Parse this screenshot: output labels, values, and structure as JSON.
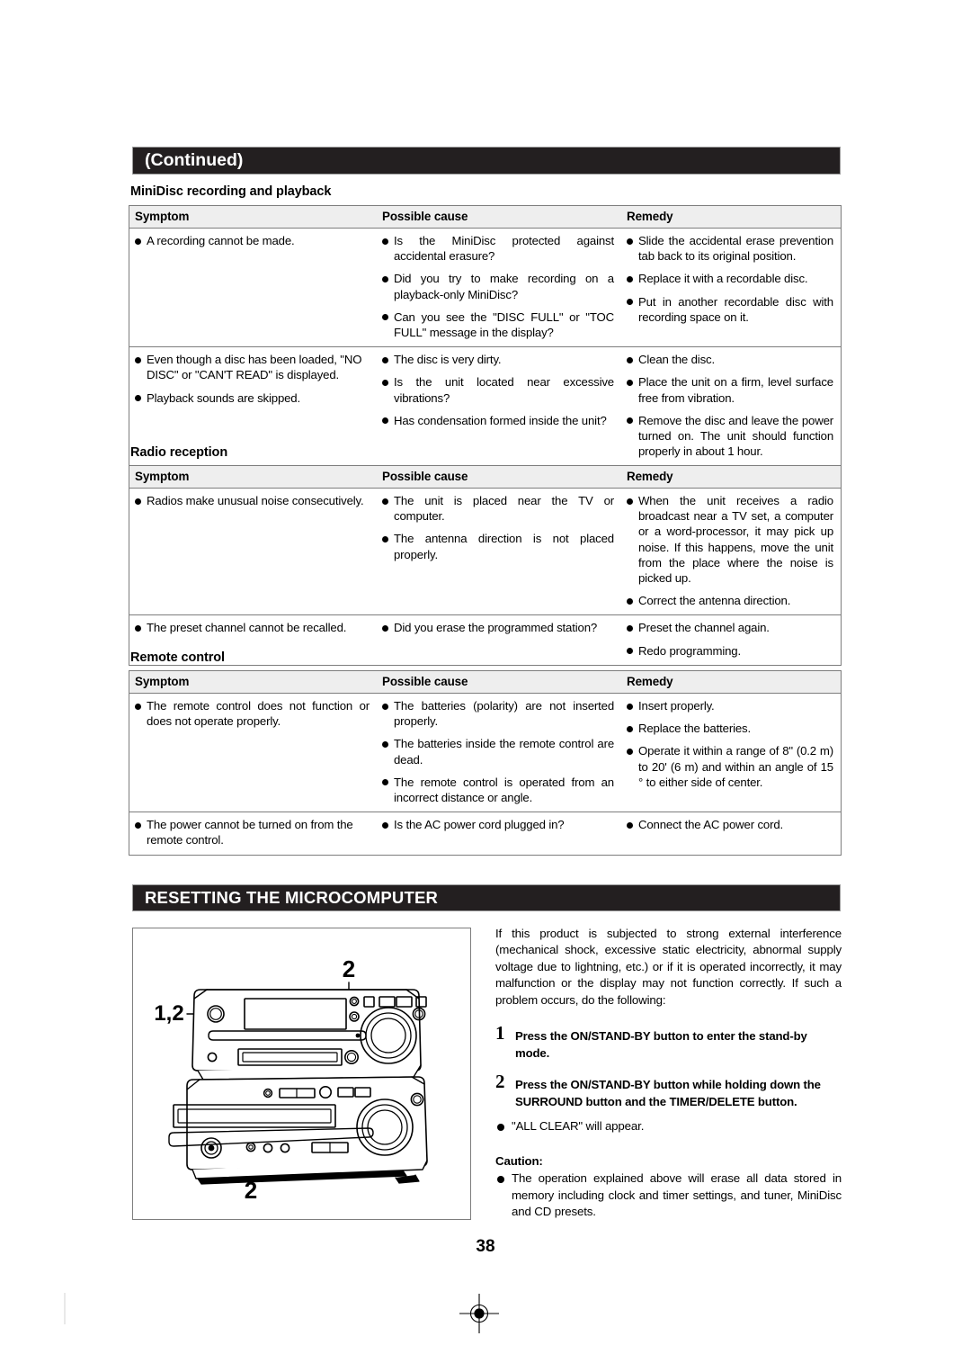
{
  "banners": {
    "continued": "(Continued)",
    "resetting": "RESETTING THE MICROCOMPUTER"
  },
  "columns": {
    "symptom": "Symptom",
    "cause": "Possible cause",
    "remedy": "Remedy"
  },
  "sections": [
    {
      "heading": "MiniDisc recording and playback",
      "rows": [
        {
          "symptom": [
            "A recording cannot be made."
          ],
          "cause": [
            "Is the MiniDisc protected against accidental erasure?",
            "Did you try to make recording on a playback-only MiniDisc?",
            "Can you see the \"DISC FULL\" or \"TOC FULL\" message in the display?"
          ],
          "remedy": [
            "Slide the accidental erase prevention tab back to its original position.",
            "Replace it with a recordable disc.",
            "Put in another recordable disc with recording space on it."
          ]
        },
        {
          "symptom": [
            "Even though a disc has been loaded, \"NO DISC\" or \"CAN'T READ\" is displayed.",
            "Playback sounds are skipped."
          ],
          "cause": [
            "The disc is very dirty.",
            "Is the unit located near excessive vibrations?",
            "Has condensation formed inside the unit?"
          ],
          "remedy": [
            "Clean the disc.",
            "Place the unit on a firm, level surface free from vibration.",
            "Remove the disc and leave the power turned on. The unit should function properly in about 1 hour."
          ]
        }
      ]
    },
    {
      "heading": "Radio reception",
      "rows": [
        {
          "symptom": [
            "Radios make unusual noise consecutively."
          ],
          "cause": [
            "The unit is placed near the TV or computer.",
            "The antenna direction is not placed properly."
          ],
          "remedy": [
            "When the unit receives a radio broadcast near a TV set, a computer or a word-processor, it may pick up noise. If this happens, move the unit from the place where the noise is picked up.",
            "Correct the antenna direction."
          ]
        },
        {
          "symptom": [
            "The preset channel cannot be recalled."
          ],
          "cause": [
            "Did you erase the programmed station?"
          ],
          "remedy": [
            "Preset the channel again.",
            "Redo programming."
          ]
        }
      ]
    },
    {
      "heading": "Remote control",
      "rows": [
        {
          "symptom": [
            "The remote control does not function or does not operate properly."
          ],
          "cause": [
            "The batteries (polarity) are not inserted properly.",
            "The batteries inside the remote control are dead.",
            "The remote control is operated from an incorrect distance or angle."
          ],
          "remedy": [
            "Insert properly.",
            "Replace the batteries.",
            "Operate it within a range of 8\" (0.2 m) to 20' (6 m) and within an angle of 15 ° to either side of center."
          ]
        },
        {
          "symptom": [
            "The power cannot be turned on from the remote control."
          ],
          "cause": [
            "Is the AC power cord plugged in?"
          ],
          "remedy": [
            "Connect the AC power cord."
          ]
        }
      ]
    }
  ],
  "resetting": {
    "intro": "If this product is subjected to strong external interference (mechanical shock, excessive static electricity, abnormal supply voltage due to lightning, etc.) or if it is operated incorrectly, it may malfunction or the display may not function correctly. If such a problem occurs, do the following:",
    "steps": [
      {
        "num": "1",
        "text": "Press the ON/STAND-BY button to enter the stand-by mode."
      },
      {
        "num": "2",
        "text": "Press the ON/STAND-BY button while holding down the SURROUND button and the TIMER/DELETE button."
      }
    ],
    "note": "\"ALL CLEAR\" will appear.",
    "caution_title": "Caution:",
    "caution_text": "The operation explained above will erase all data stored in memory including clock and timer settings, and tuner, MiniDisc and CD presets.",
    "callouts": {
      "top": "2",
      "left": "1,2",
      "bottom": "2"
    }
  },
  "footer": {
    "page_number": "38"
  }
}
